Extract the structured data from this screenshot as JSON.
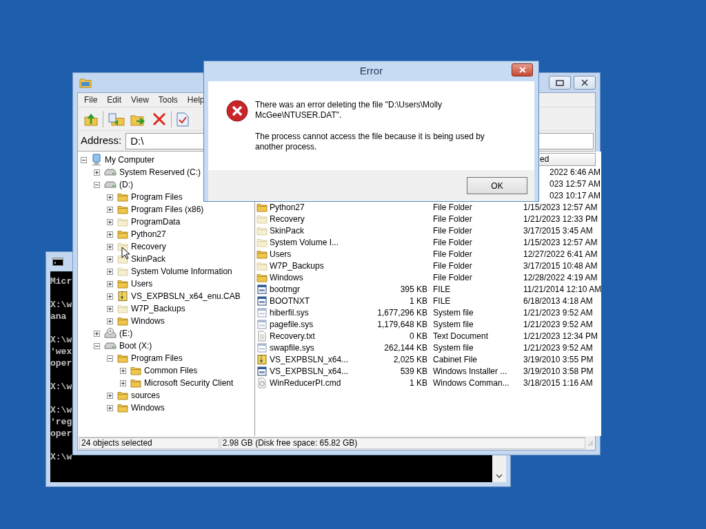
{
  "console_window": {
    "blocks": [
      [
        "Micr"
      ],
      [
        "X:\\w",
        "ana"
      ],
      [
        "X:\\w",
        "'wex",
        "oper"
      ],
      [
        "X:\\w"
      ],
      [
        "X:\\w",
        "'reg",
        "oper"
      ],
      [
        "X:\\w"
      ]
    ]
  },
  "explorer_window": {
    "menu": [
      "File",
      "Edit",
      "View",
      "Tools",
      "Help"
    ],
    "address": {
      "label": "Address:",
      "value": "D:\\"
    },
    "tree": [
      {
        "label": "My Computer",
        "kind": "computer",
        "expanded": true,
        "children": [
          {
            "label": "System Reserved (C:)",
            "kind": "drive",
            "expanded": false
          },
          {
            "label": "(D:)",
            "kind": "drive",
            "expanded": true,
            "children": [
              {
                "label": "Program Files",
                "kind": "folder",
                "hidden": false,
                "expanded": false
              },
              {
                "label": "Program Files (x86)",
                "kind": "folder",
                "hidden": false,
                "expanded": false
              },
              {
                "label": "ProgramData",
                "kind": "folder",
                "hidden": true,
                "expanded": false
              },
              {
                "label": "Python27",
                "kind": "folder",
                "hidden": false,
                "expanded": false
              },
              {
                "label": "Recovery",
                "kind": "folder",
                "hidden": true,
                "expanded": false
              },
              {
                "label": "SkinPack",
                "kind": "folder",
                "hidden": true,
                "expanded": false
              },
              {
                "label": "System Volume Information",
                "kind": "folder",
                "hidden": true,
                "expanded": false
              },
              {
                "label": "Users",
                "kind": "folder",
                "hidden": false,
                "expanded": false
              },
              {
                "label": "VS_EXPBSLN_x64_enu.CAB",
                "kind": "cab",
                "hidden": false,
                "expanded": false
              },
              {
                "label": "W7P_Backups",
                "kind": "folder",
                "hidden": true,
                "expanded": false
              },
              {
                "label": "Windows",
                "kind": "folder",
                "hidden": false,
                "expanded": false
              }
            ]
          },
          {
            "label": "(E:)",
            "kind": "optical",
            "expanded": false
          },
          {
            "label": "Boot (X:)",
            "kind": "drive",
            "expanded": true,
            "children": [
              {
                "label": "Program Files",
                "kind": "folder",
                "hidden": false,
                "expanded": true,
                "children": [
                  {
                    "label": "Common Files",
                    "kind": "folder",
                    "hidden": false,
                    "expanded": false
                  },
                  {
                    "label": "Microsoft Security Client",
                    "kind": "folder",
                    "hidden": false,
                    "expanded": false
                  }
                ]
              },
              {
                "label": "sources",
                "kind": "folder",
                "hidden": false,
                "expanded": false
              },
              {
                "label": "Windows",
                "kind": "folder",
                "hidden": false,
                "expanded": false
              }
            ]
          }
        ]
      }
    ],
    "file_list": {
      "date_header": "ed",
      "rows": [
        {
          "kind": "partial",
          "date": "2022 6:46 AM"
        },
        {
          "kind": "partial",
          "date": "023 12:57 AM"
        },
        {
          "kind": "partial",
          "date": "023 10:17 AM"
        },
        {
          "kind": "folder",
          "hidden": false,
          "name": "Python27",
          "type": "File Folder",
          "date": "1/15/2023 12:57 AM"
        },
        {
          "kind": "folder",
          "hidden": true,
          "name": "Recovery",
          "type": "File Folder",
          "date": "1/21/2023 12:33 PM"
        },
        {
          "kind": "folder",
          "hidden": true,
          "name": "SkinPack",
          "type": "File Folder",
          "date": "3/17/2015 3:45 AM"
        },
        {
          "kind": "folder",
          "hidden": true,
          "name": "System Volume I...",
          "type": "File Folder",
          "date": "1/15/2023 12:57 AM"
        },
        {
          "kind": "folder",
          "hidden": false,
          "name": "Users",
          "type": "File Folder",
          "date": "12/27/2022 6:41 AM"
        },
        {
          "kind": "folder",
          "hidden": true,
          "name": "W7P_Backups",
          "type": "File Folder",
          "date": "3/17/2015 10:48 AM"
        },
        {
          "kind": "folder",
          "hidden": false,
          "name": "Windows",
          "type": "File Folder",
          "date": "12/28/2022 4:19 AM"
        },
        {
          "kind": "app",
          "hidden": false,
          "name": "bootmgr",
          "size": "395 KB",
          "type": "FILE",
          "date": "11/21/2014 12:10 AM"
        },
        {
          "kind": "app",
          "hidden": false,
          "name": "BOOTNXT",
          "size": "1 KB",
          "type": "FILE",
          "date": "6/18/2013 4:18 AM"
        },
        {
          "kind": "app",
          "hidden": true,
          "name": "hiberfil.sys",
          "size": "1,677,296 KB",
          "type": "System file",
          "date": "1/21/2023 9:52 AM"
        },
        {
          "kind": "app",
          "hidden": true,
          "name": "pagefile.sys",
          "size": "1,179,648 KB",
          "type": "System file",
          "date": "1/21/2023 9:52 AM"
        },
        {
          "kind": "text",
          "name": "Recovery.txt",
          "size": "0 KB",
          "type": "Text Document",
          "date": "1/21/2023 12:34 PM"
        },
        {
          "kind": "app",
          "hidden": true,
          "name": "swapfile.sys",
          "size": "262,144 KB",
          "type": "System file",
          "date": "1/21/2023 9:52 AM"
        },
        {
          "kind": "cab",
          "hidden": false,
          "name": "VS_EXPBSLN_x64...",
          "size": "2,025 KB",
          "type": "Cabinet File",
          "date": "3/19/2010 3:55 PM"
        },
        {
          "kind": "app",
          "hidden": false,
          "name": "VS_EXPBSLN_x64...",
          "size": "539 KB",
          "type": "Windows Installer ...",
          "date": "3/19/2010 3:58 PM"
        },
        {
          "kind": "cmd",
          "name": "WinReducerPI.cmd",
          "size": "1 KB",
          "type": "Windows Comman...",
          "date": "3/18/2015 1:16 AM"
        }
      ]
    },
    "status_bar": [
      "24 objects selected",
      "2.98 GB (Disk free space: 65.82 GB)"
    ]
  },
  "error_dialog": {
    "title": "Error",
    "message": [
      "There was an error deleting the file \"D:\\Users\\Molly McGee\\NTUSER.DAT\".",
      "The process cannot access the file because it is being used by another process."
    ],
    "button": "OK"
  }
}
